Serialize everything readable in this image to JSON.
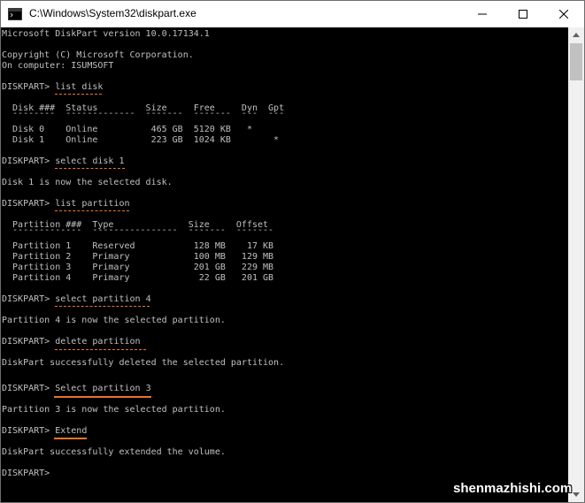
{
  "window": {
    "title": "C:\\Windows\\System32\\diskpart.exe",
    "app_icon": "console-app-icon",
    "controls": [
      "minimize-icon",
      "maximize-icon",
      "close-icon"
    ]
  },
  "console": {
    "header": {
      "version": "Microsoft DiskPart version 10.0.17134.1",
      "copyright": "Copyright (C) Microsoft Corporation.",
      "computer": "On computer: ISUMSOFT"
    },
    "cmd_list_disk": {
      "prompt": "DISKPART> ",
      "command": "list disk"
    },
    "disk_table": {
      "header": "  Disk ###  Status         Size     Free     Dyn  Gpt",
      "separator": "  --------  -------------  -------  -------  ---  ---",
      "rows": [
        "  Disk 0    Online          465 GB  5120 KB   *",
        "  Disk 1    Online          223 GB  1024 KB        *"
      ]
    },
    "cmd_select_disk": {
      "prompt": "DISKPART> ",
      "command": "select disk 1"
    },
    "msg_disk_selected": "Disk 1 is now the selected disk.",
    "cmd_list_partition": {
      "prompt": "DISKPART> ",
      "command": "list partition"
    },
    "partition_table": {
      "header": "  Partition ###  Type              Size     Offset",
      "separator": "  -------------  ----------------  -------  -------",
      "rows": [
        "  Partition 1    Reserved           128 MB    17 KB",
        "  Partition 2    Primary            100 MB   129 MB",
        "  Partition 3    Primary            201 GB   229 MB",
        "  Partition 4    Primary             22 GB   201 GB"
      ]
    },
    "cmd_select_partition4": {
      "prompt": "DISKPART> ",
      "command": "select partition 4"
    },
    "msg_partition4_selected": "Partition 4 is now the selected partition.",
    "cmd_delete_partition": {
      "prompt": "DISKPART> ",
      "command": "delete partition"
    },
    "msg_deleted": "DiskPart successfully deleted the selected partition.",
    "cmd_select_partition3": {
      "prompt": "DISKPART> ",
      "command": "Select partition 3"
    },
    "msg_partition3_selected": "Partition 3 is now the selected partition.",
    "cmd_extend": {
      "prompt": "DISKPART> ",
      "command": "Extend"
    },
    "msg_extended": "DiskPart successfully extended the volume.",
    "final_prompt": "DISKPART> "
  },
  "scrollbar": {
    "up_icon": "scroll-up-arrow-icon",
    "down_icon": "scroll-down-arrow-icon"
  },
  "watermark": "shenmazhishi.com",
  "colors": {
    "console_bg": "#000000",
    "console_text": "#c0c0c0",
    "annotation_underline": "#e8742e"
  }
}
